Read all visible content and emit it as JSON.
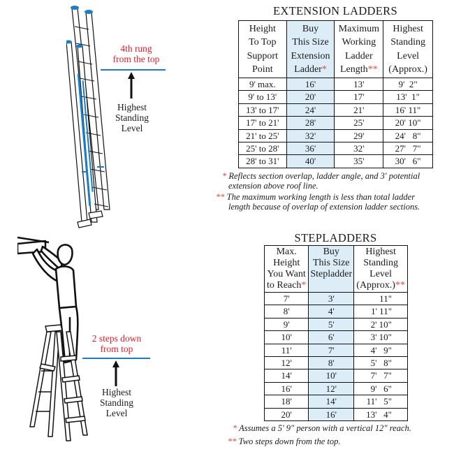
{
  "extension": {
    "title": "EXTENSION  LADDERS",
    "headers": [
      {
        "lines": [
          "Height",
          "To Top",
          "Support",
          "Point"
        ],
        "mark": ""
      },
      {
        "lines": [
          "Buy",
          "This Size",
          "Extension",
          "Ladder"
        ],
        "mark": "*"
      },
      {
        "lines": [
          "Maximum",
          "Working",
          "Ladder",
          "Length"
        ],
        "mark": "**"
      },
      {
        "lines": [
          "Highest",
          "Standing",
          "Level",
          "(Approx.)"
        ],
        "mark": ""
      }
    ],
    "rows": [
      [
        "9' max.",
        "16'",
        "13'",
        "9'  2\""
      ],
      [
        "9' to 13'",
        "20'",
        "17'",
        "13'  1\""
      ],
      [
        "13' to 17'",
        "24'",
        "21'",
        "16' 11\""
      ],
      [
        "17' to 21'",
        "28'",
        "25'",
        "20' 10\""
      ],
      [
        "21' to 25'",
        "32'",
        "29'",
        "24'   8\""
      ],
      [
        "25' to 28'",
        "36'",
        "32'",
        "27'   7\""
      ],
      [
        "28' to 31'",
        "40'",
        "35'",
        "30'   6\""
      ]
    ],
    "highlight_color": "#dcedf8",
    "notes": [
      {
        "mark": "*",
        "text": "Reflects section overlap, ladder angle, and 3' potential",
        "text2": "extension above roof line."
      },
      {
        "mark": "**",
        "text": "The maximum working length is less than total ladder",
        "text2": "length because of overlap of extension ladder sections."
      }
    ],
    "illustration": {
      "rung_label": [
        "4th rung",
        "from the top"
      ],
      "level_label": [
        "Highest",
        "Standing",
        "Level"
      ]
    }
  },
  "step": {
    "title": "STEPLADDERS",
    "headers": [
      {
        "lines": [
          "Max.",
          "Height",
          "You Want",
          "to Reach"
        ],
        "mark": "*"
      },
      {
        "lines": [
          "Buy",
          "This Size",
          "Stepladder"
        ],
        "mark": ""
      },
      {
        "lines": [
          "Highest",
          "Standing",
          "Level",
          "(Approx.)"
        ],
        "mark": "**"
      }
    ],
    "rows": [
      [
        "7'",
        "3'",
        "11\""
      ],
      [
        "8'",
        "4'",
        "1' 11\""
      ],
      [
        "9'",
        "5'",
        "2' 10\""
      ],
      [
        "10'",
        "6'",
        "3' 10\""
      ],
      [
        "11'",
        "7'",
        "4'   9\""
      ],
      [
        "12'",
        "8'",
        "5'   8\""
      ],
      [
        "14'",
        "10'",
        "7'   7\""
      ],
      [
        "16'",
        "12'",
        "9'   6\""
      ],
      [
        "18'",
        "14'",
        "11'   5\""
      ],
      [
        "20'",
        "16'",
        "13'   4\""
      ]
    ],
    "notes": [
      {
        "mark": "*",
        "text": "Assumes a 5' 9\" person with a vertical 12\" reach."
      },
      {
        "mark": "**",
        "text": "Two steps down from the top."
      }
    ],
    "illustration": {
      "step_label": [
        "2 steps down",
        "from top"
      ],
      "level_label": [
        "Highest",
        "Standing",
        "Level"
      ]
    }
  },
  "colors": {
    "accent_blue": "#1a7dc6",
    "note_red": "#e01e2a",
    "star_red": "#e0483f"
  }
}
